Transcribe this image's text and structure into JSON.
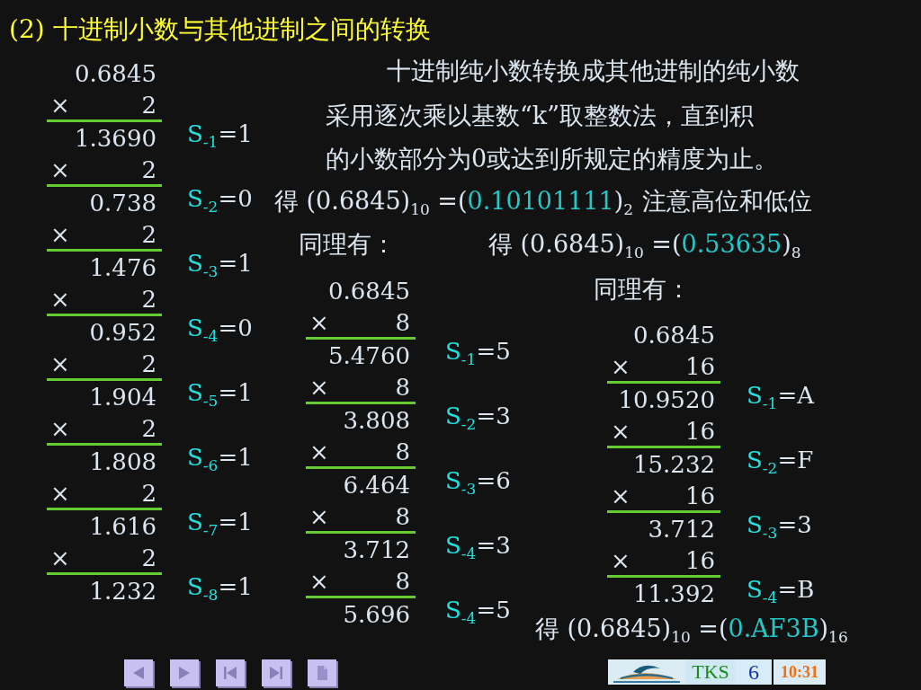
{
  "title": "(2) 十进制小数与其他进制之间的转换",
  "intro": [
    "十进制纯小数转换成其他进制的纯小数",
    "采用逐次乘以基数“k”取整数法，直到积",
    "的小数部分为0或达到所规定的精度为止。"
  ],
  "results": [
    {
      "text_before": "得 (0.6845)$_{10}$ =(",
      "digits": "0.10101111",
      "text_after": ")$_{2}$"
    },
    {
      "text_before": "得 (0.6845)$_{10}$ =(",
      "digits": "0.53635",
      "text_after": ")$_{8}$"
    },
    {
      "text_before": "得 (0.6845)$_{10}$ =(",
      "digits": "0.AF3B",
      "text_after": ")$_{16}$"
    }
  ],
  "note": "注意高位和低位",
  "similarly_labels": [
    "同理有：",
    "同理有："
  ],
  "computations": [
    {
      "multiplicand": "0.6845",
      "steps": [
        {
          "operator": "×",
          "multiplier": "2",
          "product": "1.3690",
          "digit_name": "S$_{-1}$",
          "digit_value": "=1"
        },
        {
          "operator": "×",
          "multiplier": "2",
          "product": "0.738",
          "digit_name": "S$_{-2}$",
          "digit_value": "=0"
        },
        {
          "operator": "×",
          "multiplier": "2",
          "product": "1.476",
          "digit_name": "S$_{-3}$",
          "digit_value": "=1"
        },
        {
          "operator": "×",
          "multiplier": "2",
          "product": "0.952",
          "digit_name": "S$_{-4}$",
          "digit_value": "=0"
        },
        {
          "operator": "×",
          "multiplier": "2",
          "product": "1.904",
          "digit_name": "S$_{-5}$",
          "digit_value": "=1"
        },
        {
          "operator": "×",
          "multiplier": "2",
          "product": "1.808",
          "digit_name": "S$_{-6}$",
          "digit_value": "=1"
        },
        {
          "operator": "×",
          "multiplier": "2",
          "product": "1.616",
          "digit_name": "S$_{-7}$",
          "digit_value": "=1"
        },
        {
          "operator": "×",
          "multiplier": "2",
          "product": "1.232",
          "digit_name": "S$_{-8}$",
          "digit_value": "=1"
        }
      ]
    },
    {
      "multiplicand": "0.6845",
      "steps": [
        {
          "operator": "×",
          "multiplier": "8",
          "product": "5.4760",
          "digit_name": "S$_{-1}$",
          "digit_value": "=5"
        },
        {
          "operator": "×",
          "multiplier": "8",
          "product": "3.808",
          "digit_name": "S$_{-2}$",
          "digit_value": "=3"
        },
        {
          "operator": "×",
          "multiplier": "8",
          "product": "6.464",
          "digit_name": "S$_{-3}$",
          "digit_value": "=6"
        },
        {
          "operator": "×",
          "multiplier": "8",
          "product": "3.712",
          "digit_name": "S$_{-4}$",
          "digit_value": "=3"
        },
        {
          "operator": "×",
          "multiplier": "8",
          "product": "5.696",
          "digit_name": "S$_{-4}$",
          "digit_value": "=5"
        }
      ]
    },
    {
      "multiplicand": "0.6845",
      "steps": [
        {
          "operator": "×",
          "multiplier": "16",
          "product": "10.9520",
          "digit_name": "S$_{-1}$",
          "digit_value": "=A"
        },
        {
          "operator": "×",
          "multiplier": "16",
          "product": "15.232",
          "digit_name": "S$_{-2}$",
          "digit_value": "=F"
        },
        {
          "operator": "×",
          "multiplier": "16",
          "product": "3.712",
          "digit_name": "S$_{-3}$",
          "digit_value": "=3"
        },
        {
          "operator": "×",
          "multiplier": "16",
          "product": "11.392",
          "digit_name": "S$_{-4}$",
          "digit_value": "=B"
        }
      ]
    }
  ],
  "nav_buttons": [
    {
      "kind": "previous"
    },
    {
      "kind": "next"
    },
    {
      "kind": "first"
    },
    {
      "kind": "last"
    },
    {
      "kind": "page"
    }
  ],
  "footer": {
    "label": "TKS",
    "page": "6",
    "time": "10:31"
  }
}
